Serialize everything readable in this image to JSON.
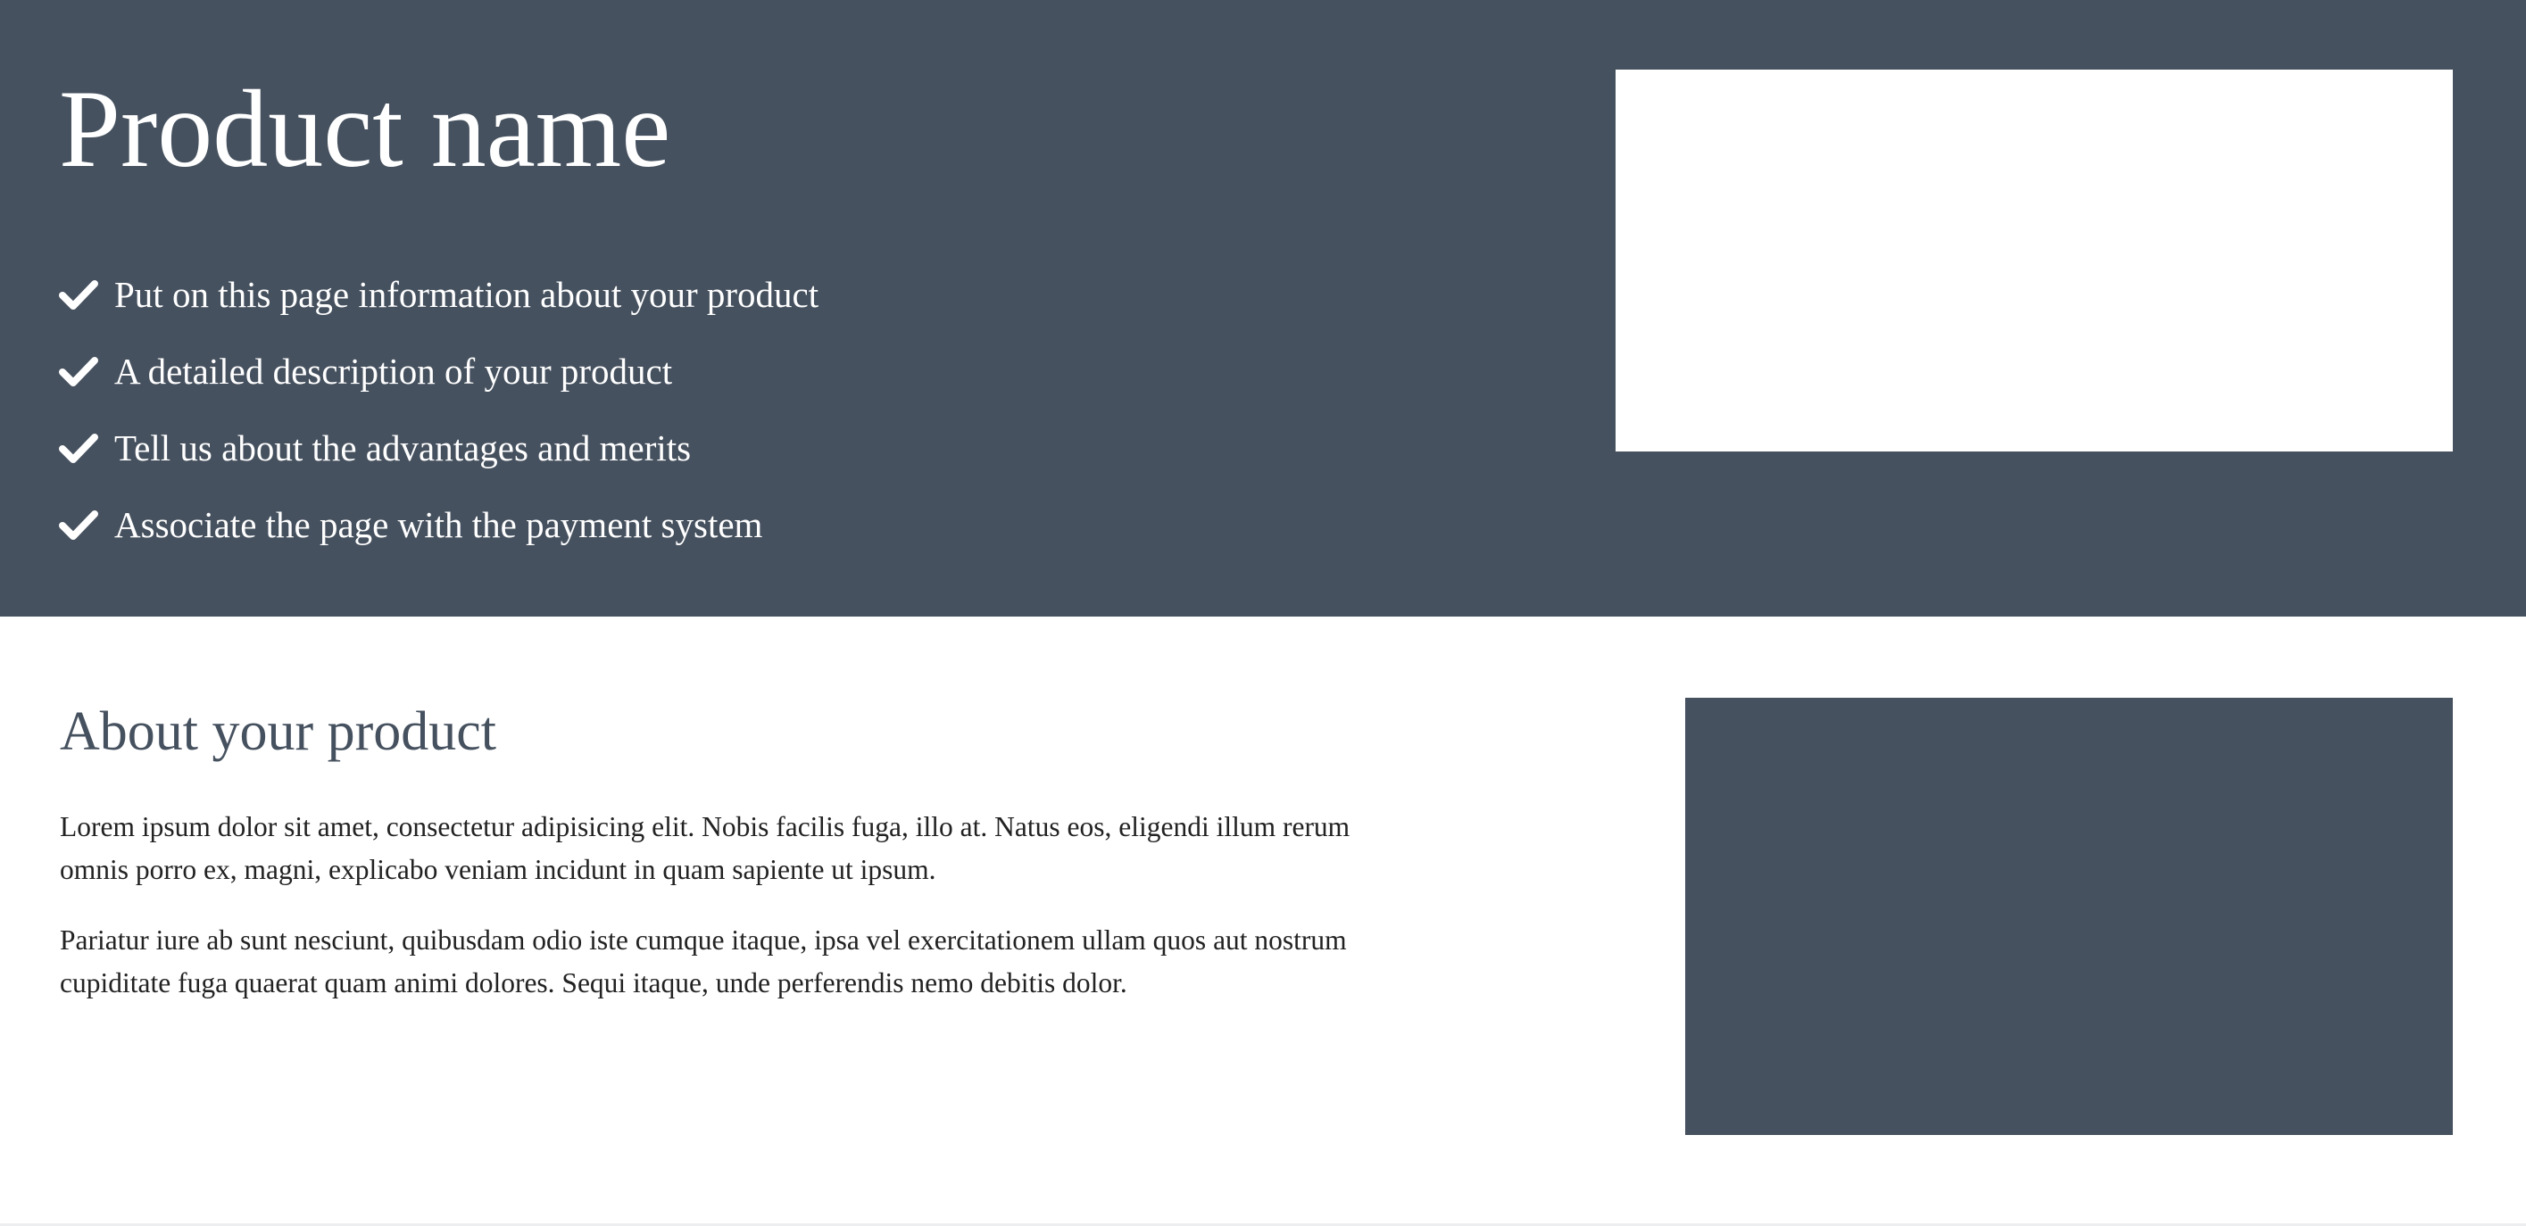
{
  "hero": {
    "title": "Product name",
    "features": [
      {
        "icon": "check-icon",
        "text": "Put on this page information about your product"
      },
      {
        "icon": "check-icon",
        "text": "A detailed description of your product"
      },
      {
        "icon": "check-icon",
        "text": "Tell us about the advantages and merits"
      },
      {
        "icon": "check-icon",
        "text": "Associate the page with the payment system"
      }
    ]
  },
  "about": {
    "title": "About your product",
    "paragraphs": [
      "Lorem ipsum dolor sit amet, consectetur adipisicing elit. Nobis facilis fuga, illo at. Natus eos, eligendi illum rerum omnis porro ex, magni, explicabo veniam incidunt in quam sapiente ut ipsum.",
      "Pariatur iure ab sunt nesciunt, quibusdam odio iste cumque itaque, ipsa vel exercitationem ullam quos aut nostrum cupiditate fuga quaerat quam animi dolores. Sequi itaque, unde perferendis nemo debitis dolor."
    ]
  },
  "colors": {
    "hero_background": "#46515f",
    "text_on_dark": "#ffffff",
    "heading_accent": "#46515f",
    "body_text": "#222222"
  }
}
